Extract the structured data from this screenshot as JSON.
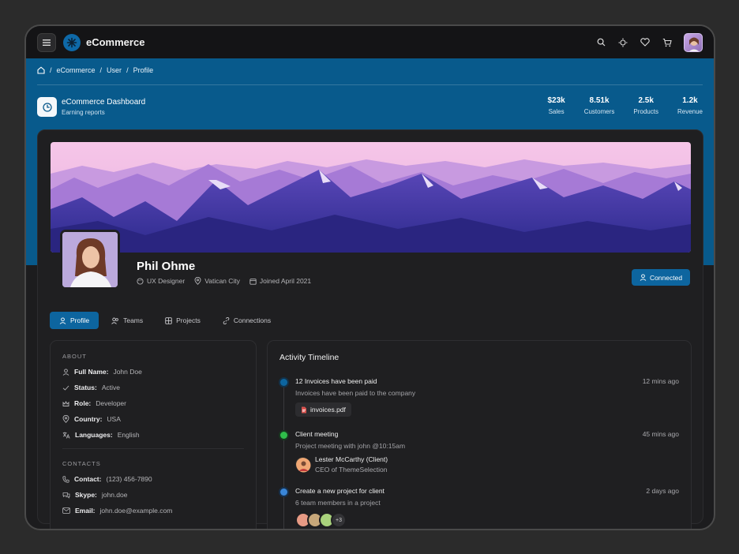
{
  "app": {
    "brand": "eCommerce"
  },
  "breadcrumb": [
    "eCommerce",
    "User",
    "Profile"
  ],
  "dashboard": {
    "title": "eCommerce Dashboard",
    "subtitle": "Earning reports"
  },
  "stats": [
    {
      "value": "$23k",
      "label": "Sales"
    },
    {
      "value": "8.51k",
      "label": "Customers"
    },
    {
      "value": "2.5k",
      "label": "Products"
    },
    {
      "value": "1.2k",
      "label": "Revenue"
    }
  ],
  "profile": {
    "name": "Phil Ohme",
    "role": "UX Designer",
    "location": "Vatican City",
    "joined": "Joined April 2021",
    "connect_label": "Connected"
  },
  "tabs": [
    "Profile",
    "Teams",
    "Projects",
    "Connections"
  ],
  "about": {
    "heading": "ABOUT",
    "rows": [
      {
        "key": "Full Name:",
        "value": "John Doe"
      },
      {
        "key": "Status:",
        "value": "Active"
      },
      {
        "key": "Role:",
        "value": "Developer"
      },
      {
        "key": "Country:",
        "value": "USA"
      },
      {
        "key": "Languages:",
        "value": "English"
      }
    ],
    "contacts_heading": "CONTACTS",
    "contacts": [
      {
        "key": "Contact:",
        "value": "(123) 456-7890"
      },
      {
        "key": "Skype:",
        "value": "john.doe"
      },
      {
        "key": "Email:",
        "value": "john.doe@example.com"
      }
    ]
  },
  "timeline": {
    "title": "Activity Timeline",
    "items": [
      {
        "title": "12 Invoices have been paid",
        "time": "12 mins ago",
        "desc": "Invoices have been paid to the company",
        "file": "invoices.pdf",
        "color": "#0d659f"
      },
      {
        "title": "Client meeting",
        "time": "45 mins ago",
        "desc": "Project meeting with john @10:15am",
        "person_name": "Lester McCarthy (Client)",
        "person_role": "CEO of ThemeSelection",
        "color": "#2fbf4a"
      },
      {
        "title": "Create a new project for client",
        "time": "2 days ago",
        "desc": "6 team members in a project",
        "more": "+3",
        "color": "#3a86d8"
      }
    ]
  },
  "colors": {
    "accent": "#0d659f",
    "hero": "#085a8c",
    "background": "#1c1c1e"
  }
}
